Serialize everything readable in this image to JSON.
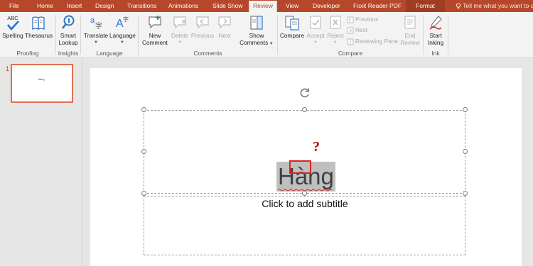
{
  "tabs": [
    {
      "label": "File"
    },
    {
      "label": "Home"
    },
    {
      "label": "Insert"
    },
    {
      "label": "Design"
    },
    {
      "label": "Transitions"
    },
    {
      "label": "Animations"
    },
    {
      "label": "Slide Show"
    },
    {
      "label": "Review"
    },
    {
      "label": "View"
    },
    {
      "label": "Developer"
    },
    {
      "label": "Foxit Reader PDF"
    },
    {
      "label": "Format"
    }
  ],
  "tell_me": "Tell me what you want to do",
  "ribbon": {
    "proofing": {
      "spelling": "Spelling",
      "spelling_icon_text": "ABC",
      "thesaurus": "Thesaurus",
      "label": "Proofing"
    },
    "insights": {
      "smart": "Smart",
      "lookup": "Lookup",
      "label": "Insights"
    },
    "language": {
      "translate": "Translate",
      "language": "Language",
      "label": "Language"
    },
    "comments": {
      "new1": "New",
      "new2": "Comment",
      "delete": "Delete",
      "previous": "Previous",
      "next": "Next",
      "show1": "Show",
      "show2": "Comments",
      "label": "Comments"
    },
    "compare": {
      "compare": "Compare",
      "accept": "Accept",
      "reject": "Reject",
      "previous": "Previous",
      "next": "Next",
      "reviewing_pane": "Reviewing Pane",
      "end1": "End",
      "end2": "Review",
      "label": "Compare"
    },
    "ink": {
      "start": "Start",
      "inking": "Inking",
      "label": "Ink"
    }
  },
  "slides": {
    "number": "1",
    "thumb_text": "Hàng"
  },
  "slide": {
    "title": "Hàng",
    "subtitle": "Click to add subtitle",
    "question_mark": "?"
  },
  "colors": {
    "accent": "#b7472a",
    "highlight": "#e02020"
  }
}
